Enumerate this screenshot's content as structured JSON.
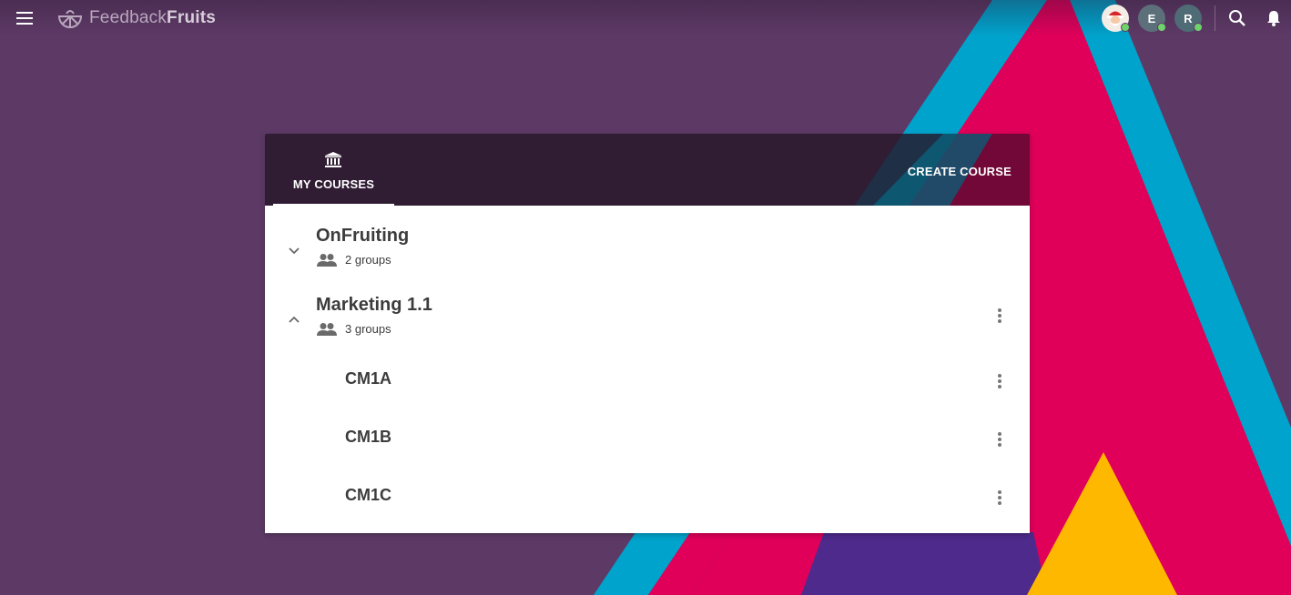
{
  "app": {
    "logo_text_light": "Feedback",
    "logo_text_bold": "Fruits"
  },
  "topbar": {
    "menu_icon": "hamburger-menu-icon",
    "avatars": [
      {
        "initial": "",
        "kind": "santa-avatar",
        "online": true
      },
      {
        "initial": "E",
        "online": true
      },
      {
        "initial": "R",
        "online": true
      }
    ],
    "search_icon": "search-icon",
    "notifications_icon": "bell-icon"
  },
  "panel": {
    "tab_label": "MY COURSES",
    "tab_icon": "institution-icon",
    "create_course_label": "CREATE COURSE"
  },
  "courses": [
    {
      "title": "OnFruiting",
      "groups_label": "2 groups",
      "expanded": false
    },
    {
      "title": "Marketing 1.1",
      "groups_label": "3 groups",
      "expanded": true,
      "groups": [
        "CM1A",
        "CM1B",
        "CM1C"
      ]
    }
  ],
  "colors": {
    "background": "#5d3a66",
    "pink": "#e0005a",
    "blue": "#00a3cc",
    "purple": "#4e2a8c",
    "yellow": "#ffb800",
    "online": "#6fd36b"
  }
}
